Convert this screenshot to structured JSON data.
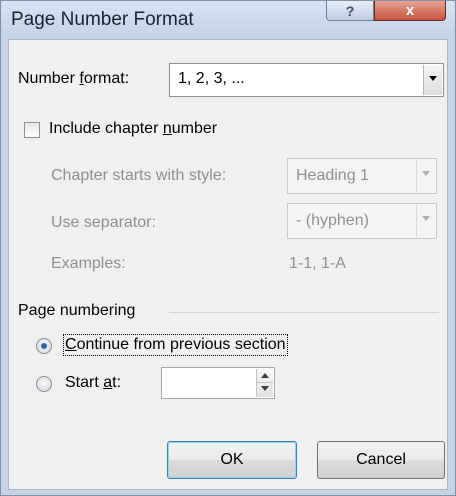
{
  "dialog": {
    "title": "Page Number Format",
    "help_label": "?",
    "close_label": "x"
  },
  "number_format": {
    "label_pre": "Number ",
    "label_accel": "f",
    "label_post": "ormat:",
    "value": "1, 2, 3, ..."
  },
  "include_chapter": {
    "label_pre": "Include chapter ",
    "label_accel": "n",
    "label_post": "umber",
    "checked": false
  },
  "chapter_style": {
    "label": "Chapter starts with style:",
    "value": "Heading 1"
  },
  "separator": {
    "label": "Use separator:",
    "value": "-   (hyphen)"
  },
  "examples": {
    "label": "Examples:",
    "value": "1-1, 1-A"
  },
  "page_numbering": {
    "heading": "Page numbering",
    "continue_accel": "C",
    "continue_rest": "ontinue from previous section",
    "start_pre": "Start ",
    "start_accel": "a",
    "start_post": "t:",
    "start_value": "",
    "selected": "continue"
  },
  "buttons": {
    "ok": "OK",
    "cancel": "Cancel"
  }
}
